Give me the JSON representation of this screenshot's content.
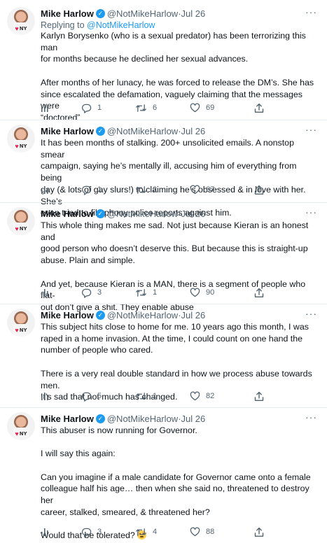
{
  "tweets": [
    {
      "name": "Mike Harlow",
      "handle": "@NotMikeHarlow",
      "date": "Jul 26",
      "reply_prefix": "Replying to ",
      "reply_handle": "@NotMikeHarlow",
      "paragraphs": [
        [
          "Karlyn Borysenko (who is a sexual predator) has been terrorizing this man",
          "for months because he declined her sexual advances."
        ],
        [
          "After months of her lunacy, he was forced to release the DM’s. She has",
          "since escalated the defamation, vaguely claiming that the messages were",
          "“doctored”"
        ]
      ],
      "stats": {
        "replies": "1",
        "retweets": "6",
        "likes": "69"
      }
    },
    {
      "name": "Mike Harlow",
      "handle": "@NotMikeHarlow",
      "date": "Jul 26",
      "paragraphs": [
        [
          "It has been months of stalking. 200+ unsolicited emails. A nonstop smear",
          "campaign, saying he’s mentally ill, accusing him of everything from being",
          "gay (& lots of gay slurs!) to claiming he’s obsessed & in love with her. She’s",
          "even tried to file phony police reports against him."
        ]
      ],
      "stats": {
        "replies": "1",
        "retweets": "2",
        "likes": "67"
      }
    },
    {
      "name": "Mike Harlow",
      "handle": "@NotMikeHarlow",
      "date": "Jul 26",
      "paragraphs": [
        [
          "This whole thing makes me sad. Not just because Kieran is an honest and",
          "good person who doesn’t deserve this. But because this is straight-up",
          "abuse. Plain and simple."
        ],
        [
          "And yet, because Kieran is a MAN, there is a segment of people who flat-",
          "out don’t give a shit. They enable abuse"
        ]
      ],
      "stats": {
        "replies": "3",
        "retweets": "1",
        "likes": "90"
      }
    },
    {
      "name": "Mike Harlow",
      "handle": "@NotMikeHarlow",
      "date": "Jul 26",
      "paragraphs": [
        [
          "This subject hits close to home for me. 10 years ago this month, I was",
          "raped in a home invasion. At the time, I could count on one hand the",
          "number of people who cared."
        ],
        [
          "There is a very real double standard in how we process abuse towards men.",
          "It’s sad that not much has changed."
        ]
      ],
      "stats": {
        "replies": "5",
        "retweets": "1",
        "likes": "82"
      }
    },
    {
      "name": "Mike Harlow",
      "handle": "@NotMikeHarlow",
      "date": "Jul 26",
      "paragraphs": [
        [
          "This abuser is now running for Governor."
        ],
        [
          "I will say this again:"
        ],
        [
          "Can you imagine if a male candidate for Governor came onto a female",
          "colleague half his age… then when she said no, threatened to destroy her",
          "career, stalked, smeared, & threatened her?"
        ],
        [
          "Would that be tolerated?"
        ]
      ],
      "end_emoji": "thinking-face-emoji",
      "stats": {
        "replies": "3",
        "retweets": "4",
        "likes": "88"
      }
    }
  ],
  "separator": " · ",
  "more_icon": "more-horizontal-icon",
  "colors": {
    "accent": "#1d9bf0",
    "muted": "#536471",
    "text": "#0f1419"
  }
}
